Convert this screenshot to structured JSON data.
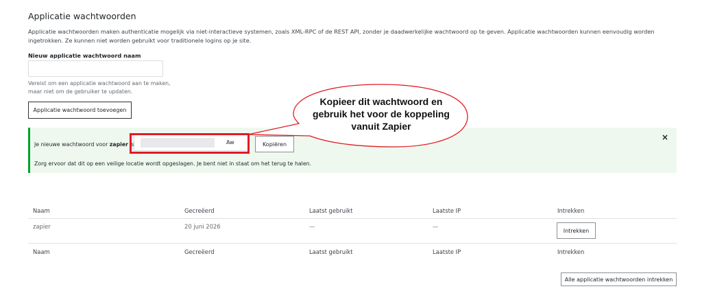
{
  "section": {
    "title": "Applicatie wachtwoorden",
    "description": "Applicatie wachtwoorden maken authenticatie mogelijk via niet-interactieve systemen, zoals XML-RPC of de REST API, zonder je daadwerkelijke wachtwoord op te geven. Applicatie wachtwoorden kunnen eenvoudig worden ingetrokken. Ze kunnen niet worden gebruikt voor traditionele logins op je site."
  },
  "form": {
    "name_label": "Nieuw applicatie wachtwoord naam",
    "name_value": "",
    "hint": "Vereist om een applicatie wachtwoord aan te maken, maar niet om de gebruiker te updaten.",
    "add_button": "Applicatie wachtwoord toevoegen"
  },
  "notice": {
    "prefix": "Je nieuwe wachtwoord voor ",
    "app_name": "zapier",
    "suffix": " is:",
    "password_tail": "Aw",
    "copy_button": "Kopiëren",
    "close": "×",
    "warning": "Zorg ervoor dat dit op een veilige locatie wordt opgeslagen. Je bent niet in staat om het terug te halen."
  },
  "callout": {
    "text": "Kopieer dit wachtwoord en gebruik het voor de koppeling vanuit Zapier"
  },
  "table": {
    "headers": [
      "Naam",
      "Gecreëerd",
      "Laatst gebruikt",
      "Laatste IP",
      "Intrekken"
    ],
    "rows": [
      {
        "name": "zapier",
        "created": "20 juni 2026",
        "last_used": "—",
        "last_ip": "—",
        "revoke": "Intrekken"
      }
    ]
  },
  "revoke_all_button": "Alle applicatie wachtwoorden intrekken",
  "colors": {
    "notice_bg": "#eff8ef",
    "notice_border": "#00a32a",
    "highlight": "#e11b22",
    "callout_border": "#e11b22"
  }
}
